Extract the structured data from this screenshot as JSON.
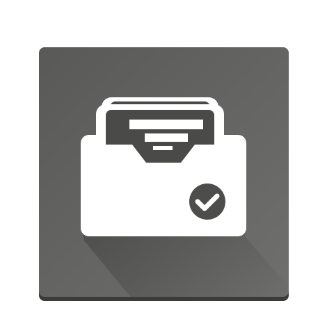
{
  "app_icon": {
    "name": "file-archive-approved",
    "icon_glyphs": [
      "folder-icon",
      "document-stack-icon",
      "checkmark-badge-icon"
    ],
    "colors": {
      "tile_gradient_start": "#595958",
      "tile_gradient_end": "#6f706e",
      "tile_shadow": "#3a3b39",
      "long_shadow": "#3e3f3d",
      "glyph": "#ffffff",
      "glyph_dark": "#4a4a49",
      "badge": "#4d4d4c",
      "check": "#ffffff"
    }
  }
}
